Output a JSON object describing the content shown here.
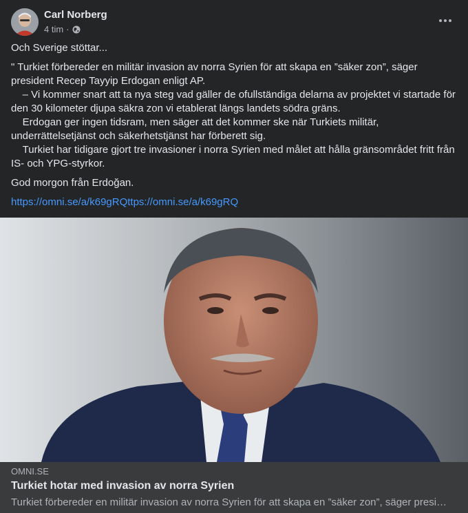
{
  "post": {
    "author": "Carl Norberg",
    "timestamp": "4 tim",
    "separator": "·",
    "privacy_icon": "globe-icon",
    "more_icon": "more-options-icon",
    "paragraphs": [
      "Och Sverige stöttar...",
      "\" Turkiet förbereder en militär invasion av norra Syrien för att skapa en ”säker zon”, säger president Recep Tayyip Erdogan enligt AP.\n    – Vi kommer snart att ta nya steg vad gäller de ofullständiga delarna av projektet vi startade för den 30 kilometer djupa säkra zon vi etablerat längs landets södra gräns.\n    Erdogan ger ingen tidsram, men säger att det kommer ske när Turkiets militär, underrättelsetjänst och säkerhetstjänst har förberett sig.\n    Turkiet har tidigare gjort tre invasioner i norra Syrien med målet att hålla gränsområdet fritt från IS- och YPG-styrkor.",
      "God morgon från Erdoğan."
    ],
    "link": "https://omni.se/a/k69gRQttps://omni.se/a/k69gRQ"
  },
  "preview": {
    "domain": "OMNI.SE",
    "title": "Turkiet hotar med invasion av norra Syrien",
    "description": "Turkiet förbereder en militär invasion av norra Syrien för att skapa en ”säker zon”, säger presi…"
  },
  "colors": {
    "card_background": "#242526",
    "preview_background": "#3a3b3c",
    "primary_text": "#e4e6eb",
    "secondary_text": "#b0b3b8",
    "link": "#4599ff"
  }
}
